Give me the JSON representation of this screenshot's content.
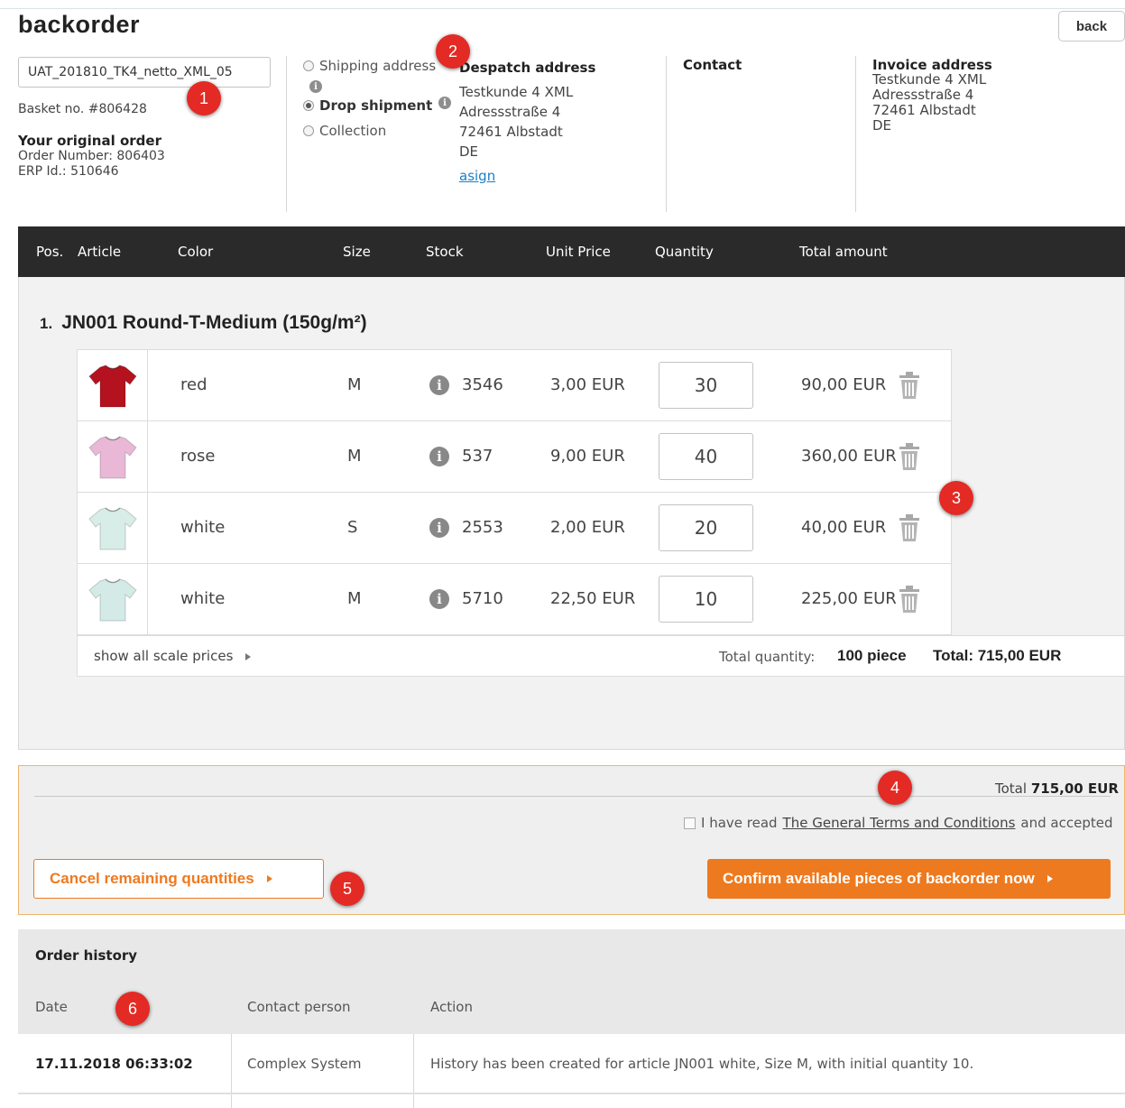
{
  "header": {
    "title": "backorder",
    "back_label": "back"
  },
  "order": {
    "reference_value": "UAT_201810_TK4_netto_XML_05",
    "basket_no": "Basket no. #806428",
    "original_order_title": "Your original order",
    "order_number": "Order Number: 806403",
    "erp_id": "ERP Id.: 510646"
  },
  "delivery": {
    "options": [
      {
        "label": "Shipping address",
        "selected": false
      },
      {
        "label": "Drop shipment",
        "selected": true
      },
      {
        "label": "Collection",
        "selected": false
      }
    ]
  },
  "despatch": {
    "title": "Despatch address",
    "lines": [
      "Testkunde 4 XML",
      "Adressstraße 4",
      "72461 Albstadt",
      "DE"
    ],
    "link": "asign"
  },
  "contact": {
    "title": "Contact"
  },
  "invoice": {
    "title": "Invoice address",
    "lines": [
      "Testkunde 4 XML",
      "Adressstraße 4",
      "72461 Albstadt",
      "DE"
    ]
  },
  "table": {
    "headers": [
      "Pos.",
      "Article",
      "Color",
      "Size",
      "Stock",
      "Unit Price",
      "Quantity",
      "Total amount"
    ]
  },
  "article": {
    "position": "1.",
    "name": "JN001 Round-T-Medium (150g/m²)",
    "rows": [
      {
        "shirt_color": "#b3121e",
        "color": "red",
        "size": "M",
        "stock": "3546",
        "unit_price": "3,00 EUR",
        "quantity": "30",
        "total": "90,00 EUR"
      },
      {
        "shirt_color": "#e8b8d6",
        "color": "rose",
        "size": "M",
        "stock": "537",
        "unit_price": "9,00 EUR",
        "quantity": "40",
        "total": "360,00 EUR"
      },
      {
        "shirt_color": "#d8ece8",
        "color": "white",
        "size": "S",
        "stock": "2553",
        "unit_price": "2,00 EUR",
        "quantity": "20",
        "total": "40,00 EUR"
      },
      {
        "shirt_color": "#d4eae6",
        "color": "white",
        "size": "M",
        "stock": "5710",
        "unit_price": "22,50 EUR",
        "quantity": "10",
        "total": "225,00 EUR"
      }
    ],
    "scale_prices_label": "show all scale prices",
    "total_quantity_label": "Total quantity:",
    "total_quantity_value": "100 piece",
    "total_label": "Total: 715,00 EUR"
  },
  "checkout": {
    "total_label": "Total",
    "total_value": "715,00 EUR",
    "terms_prefix": "I have read",
    "terms_link": "The General Terms and Conditions",
    "terms_suffix": "and accepted",
    "cancel_label": "Cancel remaining quantities",
    "confirm_label": "Confirm available pieces of backorder now"
  },
  "history": {
    "title": "Order history",
    "headers": [
      "Date",
      "Contact person",
      "Action"
    ],
    "rows": [
      {
        "date": "17.11.2018 06:33:02",
        "contact": "Complex System",
        "action": "History has been created for article JN001 white, Size M, with initial quantity 10."
      }
    ]
  },
  "markers": [
    "1",
    "2",
    "3",
    "4",
    "5",
    "6"
  ],
  "colors": {
    "accent": "#ee7a1f",
    "marker": "#e32a24",
    "header_bg": "#2a2a2a",
    "link": "#1a7fc9"
  }
}
